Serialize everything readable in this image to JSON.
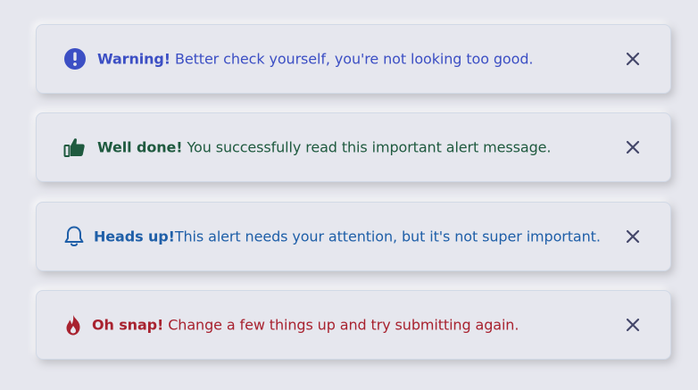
{
  "alerts": [
    {
      "type": "warning",
      "icon": "exclamation-circle-icon",
      "color": "#3c4fc4",
      "title": "Warning!",
      "message": " Better check yourself, you're not looking too good."
    },
    {
      "type": "success",
      "icon": "thumbs-up-icon",
      "color": "#1f5a3f",
      "title": "Well done!",
      "message": " You successfully read this important alert message."
    },
    {
      "type": "info",
      "icon": "bell-icon",
      "color": "#1f5fa8",
      "title": "Heads up!",
      "message": "This alert needs your attention, but it's not super important."
    },
    {
      "type": "danger",
      "icon": "fire-icon",
      "color": "#a8222f",
      "title": "Oh snap!",
      "message": " Change a few things up and try submitting again."
    }
  ],
  "close_icon": "close-icon",
  "close_color": "#44476a"
}
